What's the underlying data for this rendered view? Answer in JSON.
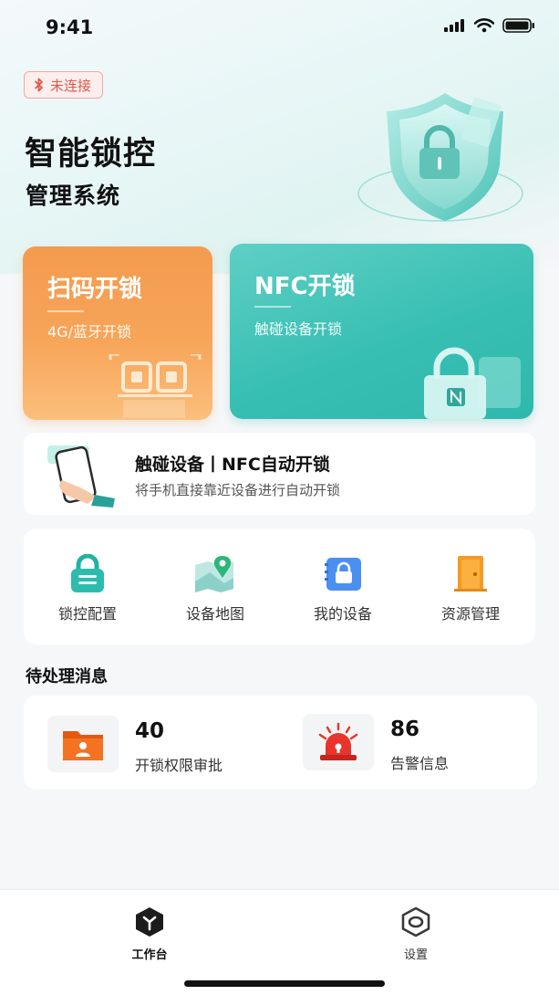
{
  "status_bar": {
    "time": "9:41"
  },
  "header": {
    "bluetooth_status": "未连接",
    "title": "智能锁控",
    "subtitle": "管理系统"
  },
  "cards": {
    "scan": {
      "title": "扫码开锁",
      "subtitle": "4G/蓝牙开锁",
      "color": "#f39b4f"
    },
    "nfc": {
      "title": "NFC开锁",
      "subtitle": "触碰设备开锁",
      "color": "#38bfb3"
    }
  },
  "nfc_banner": {
    "title": "触碰设备丨NFC自动开锁",
    "description": "将手机直接靠近设备进行自动开锁"
  },
  "quick_actions": [
    {
      "label": "锁控配置",
      "icon": "lock-config-icon"
    },
    {
      "label": "设备地图",
      "icon": "device-map-icon"
    },
    {
      "label": "我的设备",
      "icon": "my-device-icon"
    },
    {
      "label": "资源管理",
      "icon": "resource-icon"
    }
  ],
  "pending": {
    "title": "待处理消息",
    "items": [
      {
        "count": "40",
        "label": "开锁权限审批",
        "icon": "folder-user-icon"
      },
      {
        "count": "86",
        "label": "告警信息",
        "icon": "alarm-icon"
      }
    ]
  },
  "tab_bar": {
    "items": [
      {
        "label": "工作台",
        "active": true
      },
      {
        "label": "设置",
        "active": false
      }
    ]
  }
}
